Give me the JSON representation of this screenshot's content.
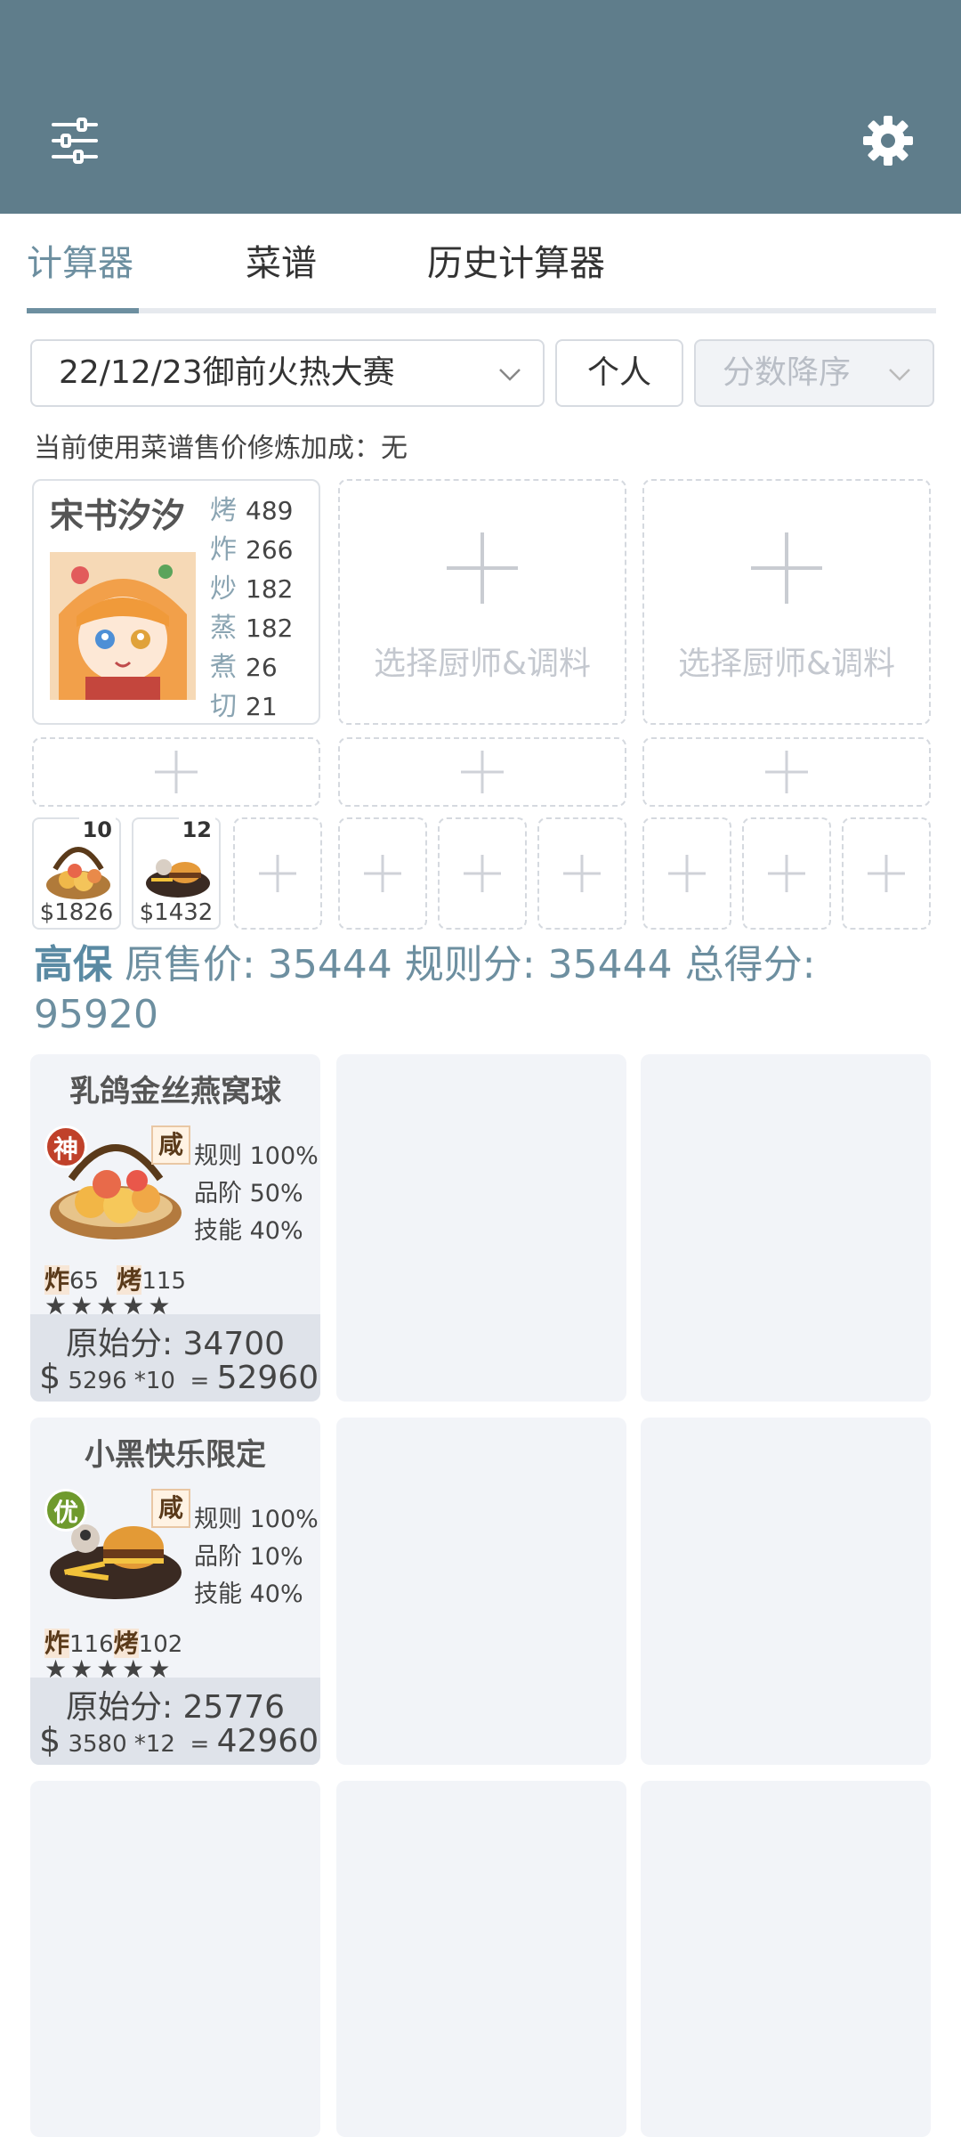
{
  "header": {
    "menu_icon": "sliders-icon",
    "settings_icon": "gear-icon",
    "bg_color": "#5f7d8b"
  },
  "tabs": [
    {
      "label": "计算器",
      "active": true
    },
    {
      "label": "菜谱",
      "active": false
    },
    {
      "label": "历史计算器",
      "active": false
    }
  ],
  "filters": {
    "contest": "22/12/23御前火热大赛",
    "mode": "个人",
    "sort": "分数降序"
  },
  "bonus_line": "当前使用菜谱售价修炼加成：无",
  "chef": {
    "name": "宋书汐汐",
    "stats": [
      {
        "k": "烤",
        "v": "489"
      },
      {
        "k": "炸",
        "v": "266"
      },
      {
        "k": "炒",
        "v": "182"
      },
      {
        "k": "蒸",
        "v": "182"
      },
      {
        "k": "煮",
        "v": "26"
      },
      {
        "k": "切",
        "v": "21"
      }
    ]
  },
  "add_chef_label": "选择厨师&调料",
  "equip": [
    {
      "level": "10",
      "price": "$1826"
    },
    {
      "level": "12",
      "price": "$1432"
    }
  ],
  "summary": {
    "guarantee": "高保",
    "orig_label": "原售价:",
    "orig_value": "35444",
    "rule_label": "规则分:",
    "rule_value": "35444",
    "total_label": "总得分:",
    "total_value": "95920"
  },
  "dishes": [
    {
      "name": "乳鸽金丝燕窝球",
      "rarity": "神",
      "rarity_color": "#c0412a",
      "flavor": "咸",
      "rule": "规则 100%",
      "grade": "品阶 50%",
      "skill": "技能 40%",
      "s1k": "炸",
      "s1v": "65",
      "s2k": "烤",
      "s2v": "115",
      "stars": "★★★★★",
      "orig": "原始分: 34700",
      "unit": "5296",
      "mult": "*10",
      "eq": "=",
      "total": "52960"
    },
    {
      "name": "小黑快乐限定",
      "rarity": "优",
      "rarity_color": "#6f9a2d",
      "flavor": "咸",
      "rule": "规则 100%",
      "grade": "品阶 10%",
      "skill": "技能 40%",
      "s1k": "炸",
      "s1v": "116",
      "s2k": "烤",
      "s2v": "102",
      "stars": "★★★★★",
      "orig": "原始分: 25776",
      "unit": "3580",
      "mult": "*12",
      "eq": "=",
      "total": "42960"
    }
  ]
}
